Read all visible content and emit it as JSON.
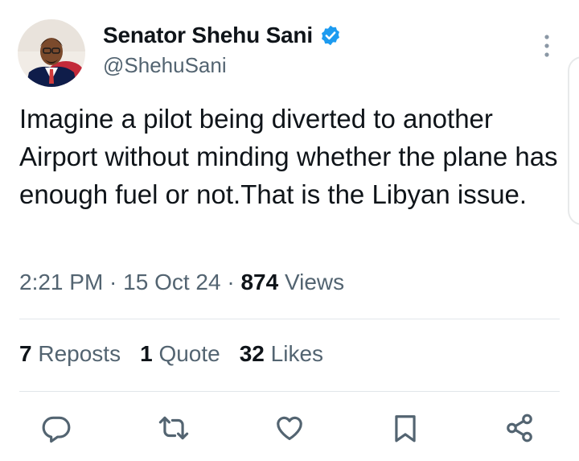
{
  "author": {
    "name": "Senator Shehu Sani",
    "handle": "@ShehuSani",
    "verified": true,
    "verified_color": "#1d9bf0"
  },
  "tweet": {
    "text": "Imagine a pilot being diverted to another Airport without minding whether the plane has enough fuel or not.That is the Libyan issue.",
    "time": "2:21 PM",
    "date": "15 Oct 24",
    "views_count": "874",
    "views_label": "Views"
  },
  "stats": {
    "reposts_count": "7",
    "reposts_label": "Reposts",
    "quotes_count": "1",
    "quotes_label": "Quote",
    "likes_count": "32",
    "likes_label": "Likes"
  },
  "actions": [
    "reply-icon",
    "repost-icon",
    "like-icon",
    "bookmark-icon",
    "share-icon"
  ],
  "colors": {
    "text": "#0f1419",
    "secondary": "#536471",
    "icon": "#536471",
    "divider": "#e1e6ea"
  }
}
